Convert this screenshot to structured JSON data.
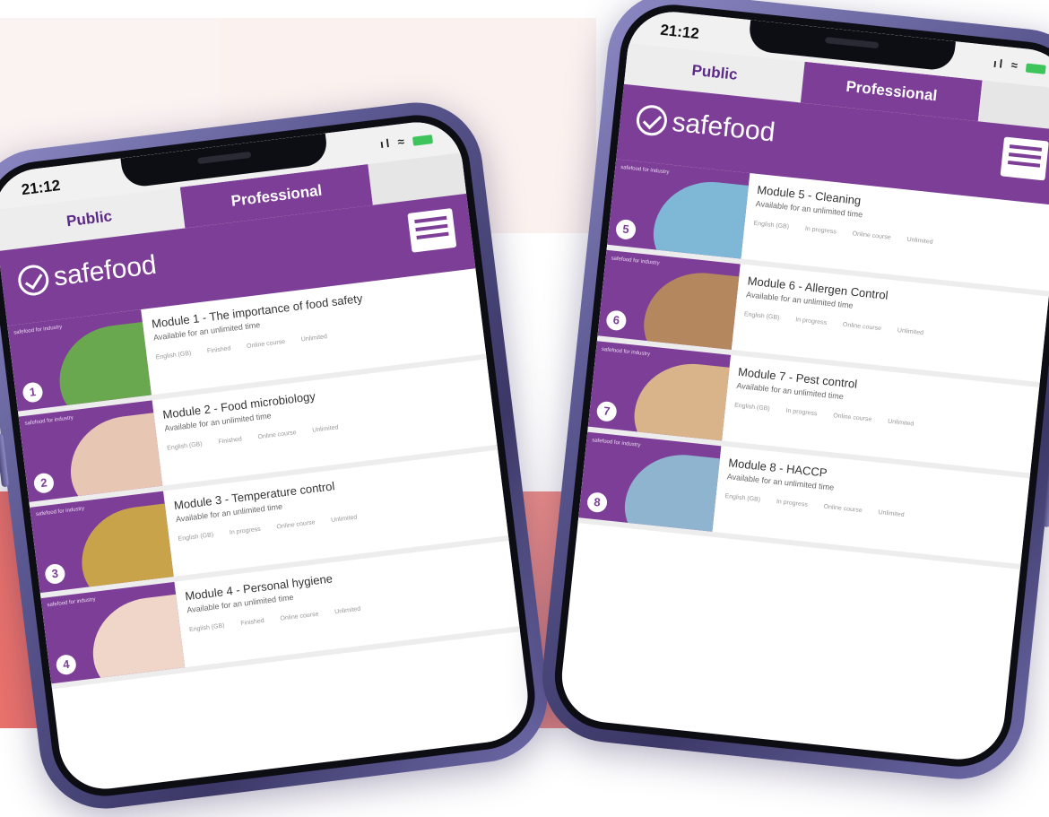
{
  "colors": {
    "brand_purple": "#7d3e97",
    "tab_inactive": "#ededed",
    "accent_red": "#e9726c",
    "phone_frame": "#5b5891"
  },
  "phones": [
    {
      "status": {
        "time": "21:12",
        "icons": "ıl ≈"
      },
      "tabs": {
        "public": "Public",
        "professional": "Professional"
      },
      "brand": "safefood",
      "modules": [
        {
          "thumb_tag": "safefood for industry",
          "num": "1",
          "title": "Module 1 - The importance of food safety",
          "availability": "Available for an unlimited time",
          "language": "English (GB)",
          "status": "Finished",
          "type": "Online course",
          "duration": "Unlimited",
          "thumb_color": "#6aa84f"
        },
        {
          "thumb_tag": "safefood for industry",
          "num": "2",
          "title": "Module 2 - Food microbiology",
          "availability": "Available for an unlimited time",
          "language": "English (GB)",
          "status": "Finished",
          "type": "Online course",
          "duration": "Unlimited",
          "thumb_color": "#e8c6b4"
        },
        {
          "thumb_tag": "safefood for industry",
          "num": "3",
          "title": "Module 3 - Temperature control",
          "availability": "Available for an unlimited time",
          "language": "English (GB)",
          "status": "In progress",
          "type": "Online course",
          "duration": "Unlimited",
          "thumb_color": "#c9a34a"
        },
        {
          "thumb_tag": "safefood for industry",
          "num": "4",
          "title": "Module 4 - Personal hygiene",
          "availability": "Available for an unlimited time",
          "language": "English (GB)",
          "status": "Finished",
          "type": "Online course",
          "duration": "Unlimited",
          "thumb_color": "#f0d6c8"
        }
      ]
    },
    {
      "status": {
        "time": "21:12",
        "icons": "ıl ≈"
      },
      "tabs": {
        "public": "Public",
        "professional": "Professional"
      },
      "brand": "safefood",
      "modules": [
        {
          "thumb_tag": "safefood for industry",
          "num": "5",
          "title": "Module 5 - Cleaning",
          "availability": "Available for an unlimited time",
          "language": "English (GB)",
          "status": "In progress",
          "type": "Online course",
          "duration": "Unlimited",
          "thumb_color": "#7fb7d6"
        },
        {
          "thumb_tag": "safefood for industry",
          "num": "6",
          "title": "Module 6 - Allergen Control",
          "availability": "Available for an unlimited time",
          "language": "English (GB)",
          "status": "In progress",
          "type": "Online course",
          "duration": "Unlimited",
          "thumb_color": "#b5875f"
        },
        {
          "thumb_tag": "safefood for industry",
          "num": "7",
          "title": "Module 7 - Pest control",
          "availability": "Available for an unlimited time",
          "language": "English (GB)",
          "status": "In progress",
          "type": "Online course",
          "duration": "Unlimited",
          "thumb_color": "#d9b48a"
        },
        {
          "thumb_tag": "safefood for industry",
          "num": "8",
          "title": "Module 8 - HACCP",
          "availability": "Available for an unlimited time",
          "language": "English (GB)",
          "status": "In progress",
          "type": "Online course",
          "duration": "Unlimited",
          "thumb_color": "#8fb4cf"
        }
      ]
    }
  ]
}
